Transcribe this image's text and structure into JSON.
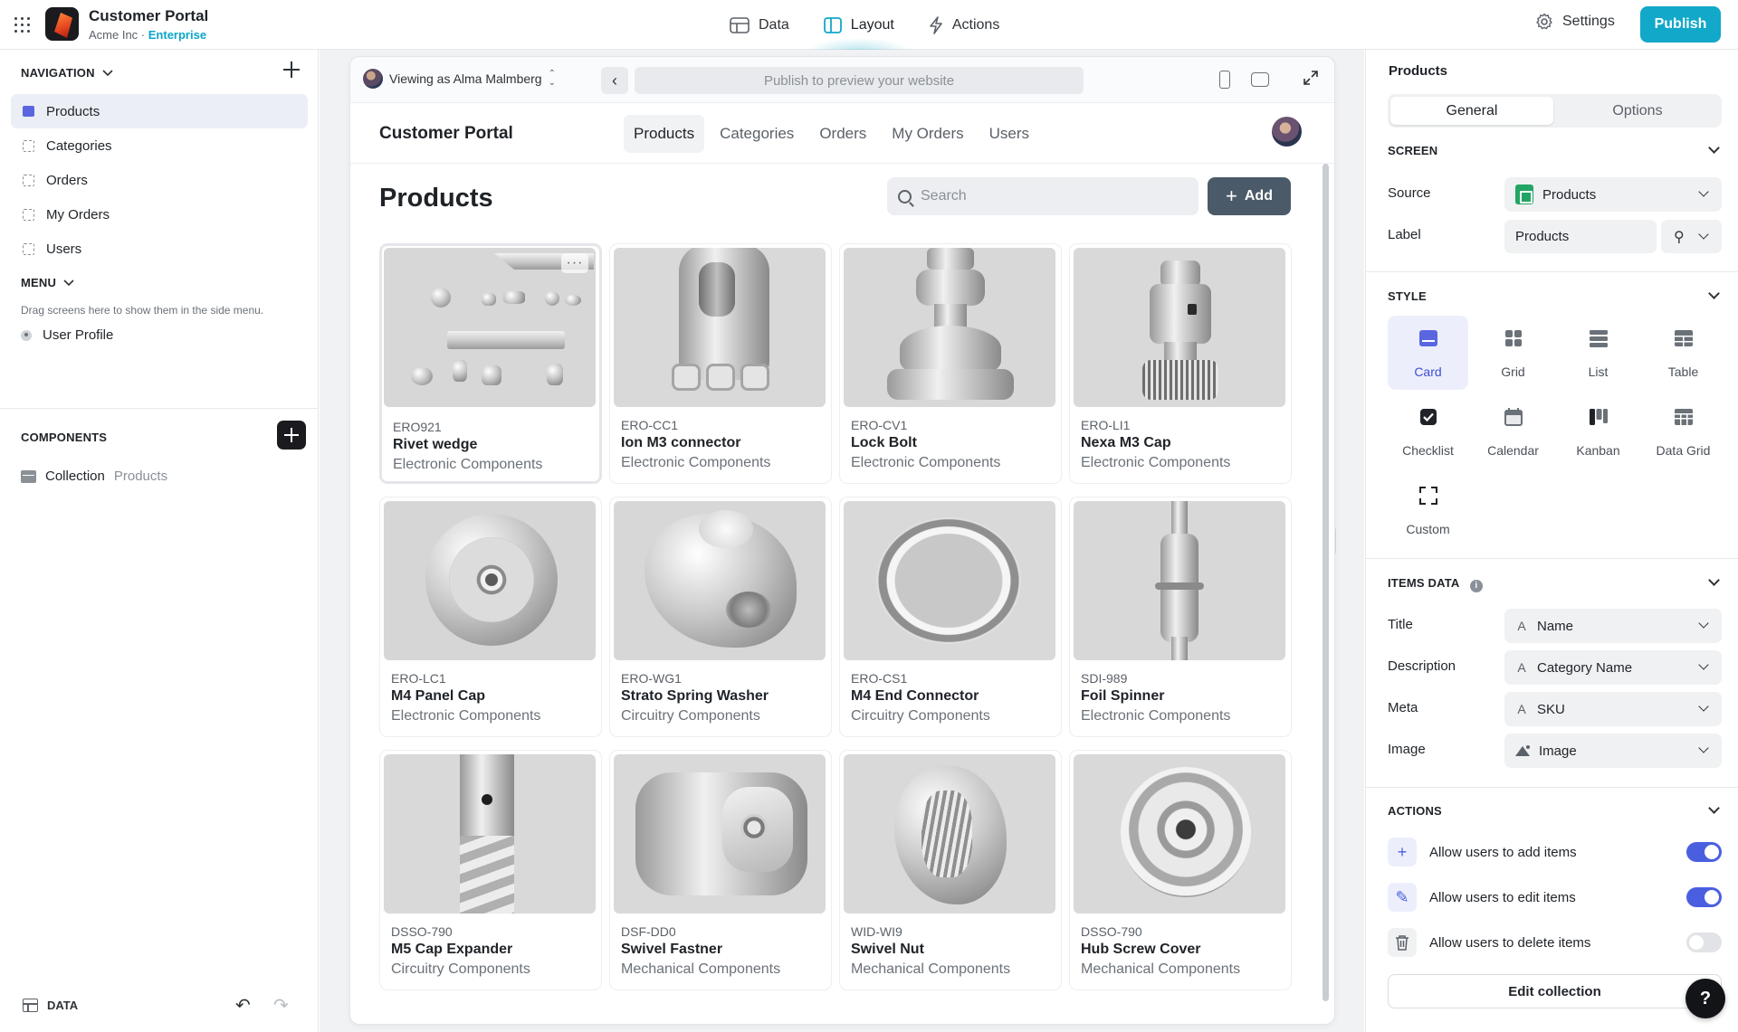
{
  "app": {
    "title": "Customer Portal",
    "org": "Acme Inc",
    "separator": " · ",
    "plan": "Enterprise"
  },
  "topnav": [
    {
      "label": "Data",
      "icon": "database-icon"
    },
    {
      "label": "Layout",
      "icon": "layout-icon",
      "active": true
    },
    {
      "label": "Actions",
      "icon": "lightning-icon"
    }
  ],
  "settings_label": "Settings",
  "publish_label": "Publish",
  "left": {
    "navigation_label": "NAVIGATION",
    "nav_items": [
      {
        "label": "Products",
        "active": true
      },
      {
        "label": "Categories"
      },
      {
        "label": "Orders"
      },
      {
        "label": "My Orders"
      },
      {
        "label": "Users"
      }
    ],
    "menu_label": "MENU",
    "menu_hint": "Drag screens here to show them in the side menu.",
    "user_profile": "User Profile",
    "components_label": "COMPONENTS",
    "collection_label": "Collection",
    "collection_source": "Products",
    "data_label": "DATA"
  },
  "preview": {
    "viewing_as": "Viewing as Alma Malmberg",
    "url_placeholder": "Publish to preview your website",
    "brand": "Customer Portal",
    "tabs": [
      "Products",
      "Categories",
      "Orders",
      "My Orders",
      "Users"
    ],
    "active_tab": "Products",
    "page_title": "Products",
    "search_placeholder": "Search",
    "add_label": "Add",
    "more_glyph": "···",
    "products": [
      {
        "sku": "ERO921",
        "name": "Rivet wedge",
        "category": "Electronic Components"
      },
      {
        "sku": "ERO-CC1",
        "name": "Ion M3 connector",
        "category": "Electronic Components"
      },
      {
        "sku": "ERO-CV1",
        "name": "Lock Bolt",
        "category": "Electronic Components"
      },
      {
        "sku": "ERO-LI1",
        "name": "Nexa M3 Cap",
        "category": "Electronic Components"
      },
      {
        "sku": "ERO-LC1",
        "name": "M4 Panel Cap",
        "category": "Electronic Components"
      },
      {
        "sku": "ERO-WG1",
        "name": "Strato Spring Washer",
        "category": "Circuitry Components"
      },
      {
        "sku": "ERO-CS1",
        "name": "M4 End Connector",
        "category": "Circuitry Components"
      },
      {
        "sku": "SDI-989",
        "name": "Foil Spinner",
        "category": "Electronic Components"
      },
      {
        "sku": "DSSO-790",
        "name": "M5 Cap Expander",
        "category": "Circuitry Components"
      },
      {
        "sku": "DSF-DD0",
        "name": "Swivel Fastner",
        "category": "Mechanical Components"
      },
      {
        "sku": "WID-WI9",
        "name": "Swivel Nut",
        "category": "Mechanical Components"
      },
      {
        "sku": "DSSO-790",
        "name": "Hub Screw Cover",
        "category": "Mechanical Components"
      }
    ]
  },
  "right": {
    "title": "Products",
    "tabs": {
      "general": "General",
      "options": "Options"
    },
    "screen_label": "SCREEN",
    "source_label": "Source",
    "source_value": "Products",
    "label_label": "Label",
    "label_value": "Products",
    "style_label": "STYLE",
    "styles": [
      "Card",
      "Grid",
      "List",
      "Table",
      "Checklist",
      "Calendar",
      "Kanban",
      "Data Grid",
      "Custom"
    ],
    "selected_style": "Card",
    "items_data_label": "ITEMS DATA",
    "info_glyph": "i",
    "fields": [
      {
        "label": "Title",
        "value": "Name",
        "icon": "text-icon"
      },
      {
        "label": "Description",
        "value": "Category Name",
        "icon": "text-icon"
      },
      {
        "label": "Meta",
        "value": "SKU",
        "icon": "text-icon"
      },
      {
        "label": "Image",
        "value": "Image",
        "icon": "image-icon"
      }
    ],
    "text_glyph": "A",
    "actions_label": "ACTIONS",
    "actions": [
      {
        "label": "Allow users to add items",
        "enabled": true
      },
      {
        "label": "Allow users to edit items",
        "enabled": true
      },
      {
        "label": "Allow users to delete items",
        "enabled": false
      }
    ],
    "edit_collection": "Edit collection"
  },
  "help_glyph": "?",
  "colors": {
    "accent": "#12a8c9",
    "selection": "#4a5fe0",
    "add_button": "#4a5a68"
  }
}
